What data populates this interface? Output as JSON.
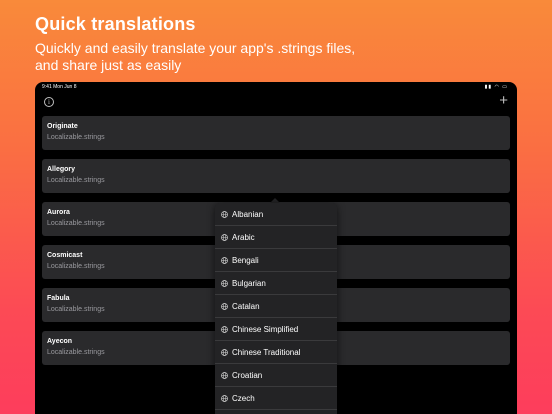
{
  "promo": {
    "headline": "Quick translations",
    "subline1": "Quickly and easily translate your app's .strings files,",
    "subline2": "and share just as easily"
  },
  "status": {
    "time": "9:41",
    "date": "Mon Jun 8",
    "icons": "▮▮ ◠ ▭"
  },
  "toolbar": {
    "info_icon": "i",
    "add_icon": "+"
  },
  "files": [
    {
      "name": "Originate",
      "file": "Localizable.strings"
    },
    {
      "name": "Allegory",
      "file": "Localizable.strings"
    },
    {
      "name": "Aurora",
      "file": "Localizable.strings"
    },
    {
      "name": "Cosmicast",
      "file": "Localizable.strings"
    },
    {
      "name": "Fabula",
      "file": "Localizable.strings"
    },
    {
      "name": "Ayecon",
      "file": "Localizable.strings"
    }
  ],
  "languages": [
    "Albanian",
    "Arabic",
    "Bengali",
    "Bulgarian",
    "Catalan",
    "Chinese Simplified",
    "Chinese Traditional",
    "Croatian",
    "Czech"
  ],
  "colors": {
    "gradient_top": "#f98a3a",
    "gradient_bottom": "#fd3d5c",
    "card": "#2a2a2c",
    "popover": "#232325"
  }
}
